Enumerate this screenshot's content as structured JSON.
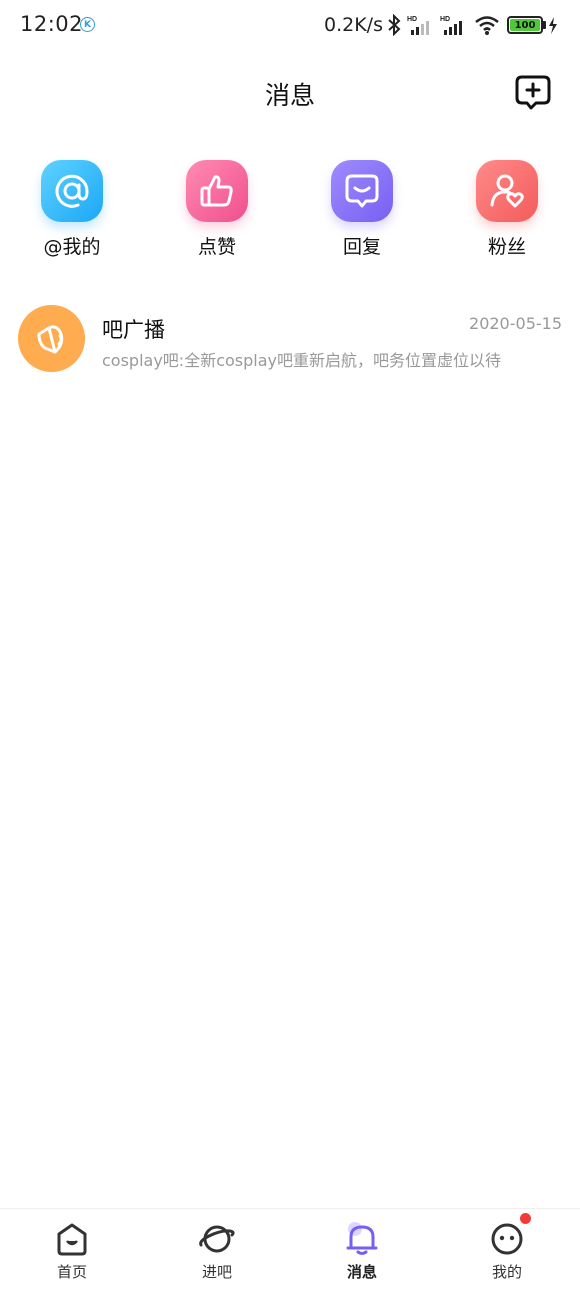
{
  "status_bar": {
    "time": "12:02",
    "k_badge": "K",
    "speed": "0.2K/s",
    "battery": "100",
    "icons": [
      "bluetooth-icon",
      "signal-hd-icon",
      "signal-hd-icon",
      "wifi-icon",
      "battery-icon",
      "charging-icon"
    ]
  },
  "header": {
    "title": "消息",
    "compose_icon": "add-chat-icon"
  },
  "quick_actions": [
    {
      "label": "@我的",
      "icon": "at-icon",
      "color": "#1ba7f5"
    },
    {
      "label": "点赞",
      "icon": "thumbs-up-icon",
      "color": "#f04f8c"
    },
    {
      "label": "回复",
      "icon": "reply-bubble-icon",
      "color": "#7660f2"
    },
    {
      "label": "粉丝",
      "icon": "fan-heart-icon",
      "color": "#f45b5b"
    }
  ],
  "messages": [
    {
      "title": "吧广播",
      "date": "2020-05-15",
      "preview": "cosplay吧:全新cosplay吧重新启航，吧务位置虚位以待",
      "icon": "broadcast-speaker-icon",
      "avatar_color": "#ffab4f"
    }
  ],
  "bottom_nav": [
    {
      "label": "首页",
      "icon": "home-icon",
      "active": false
    },
    {
      "label": "进吧",
      "icon": "planet-icon",
      "active": false
    },
    {
      "label": "消息",
      "icon": "bell-icon",
      "active": true
    },
    {
      "label": "我的",
      "icon": "face-icon",
      "active": false,
      "badge": true
    }
  ],
  "colors": {
    "accent_purple": "#7660f2",
    "badge_red": "#f23a3a"
  }
}
